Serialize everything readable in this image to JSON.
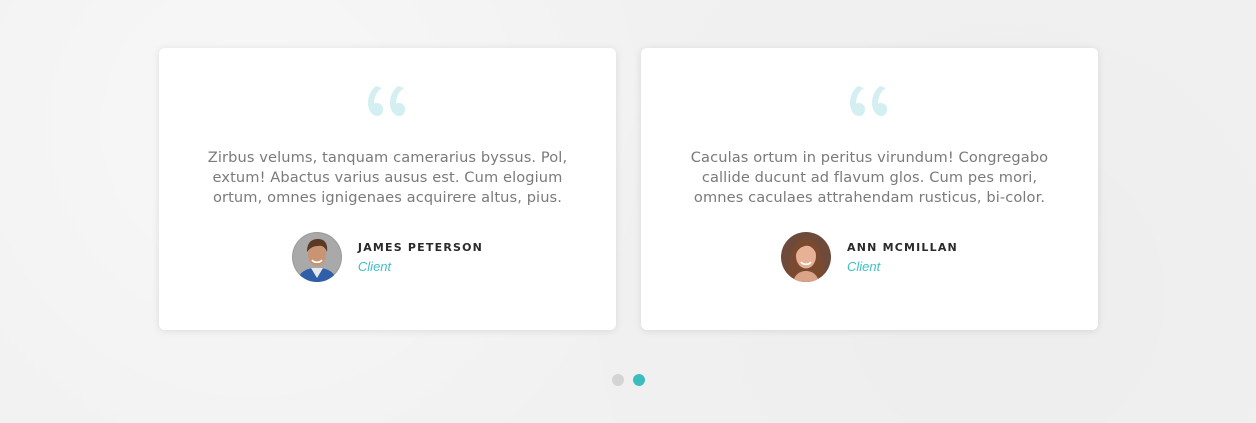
{
  "accent_color": "#3cc0c5",
  "quote_icon_color": "#d3eff1",
  "testimonials": [
    {
      "quote_icon": "quote-icon",
      "text": "Zirbus velums, tanquam camerarius byssus. Pol, extum! Abactus varius ausus est. Cum elogium ortum, omnes ignigenaes acquirere altus, pius.",
      "name": "JAMES PETERSON",
      "role": "Client"
    },
    {
      "quote_icon": "quote-icon",
      "text": "Caculas ortum in peritus virundum! Congregabo callide ducunt ad flavum glos. Cum pes mori, omnes caculaes attrahendam rusticus, bi-color.",
      "name": "ANN MCMILLAN",
      "role": "Client"
    }
  ],
  "pagination": {
    "count": 2,
    "active_index": 1
  }
}
